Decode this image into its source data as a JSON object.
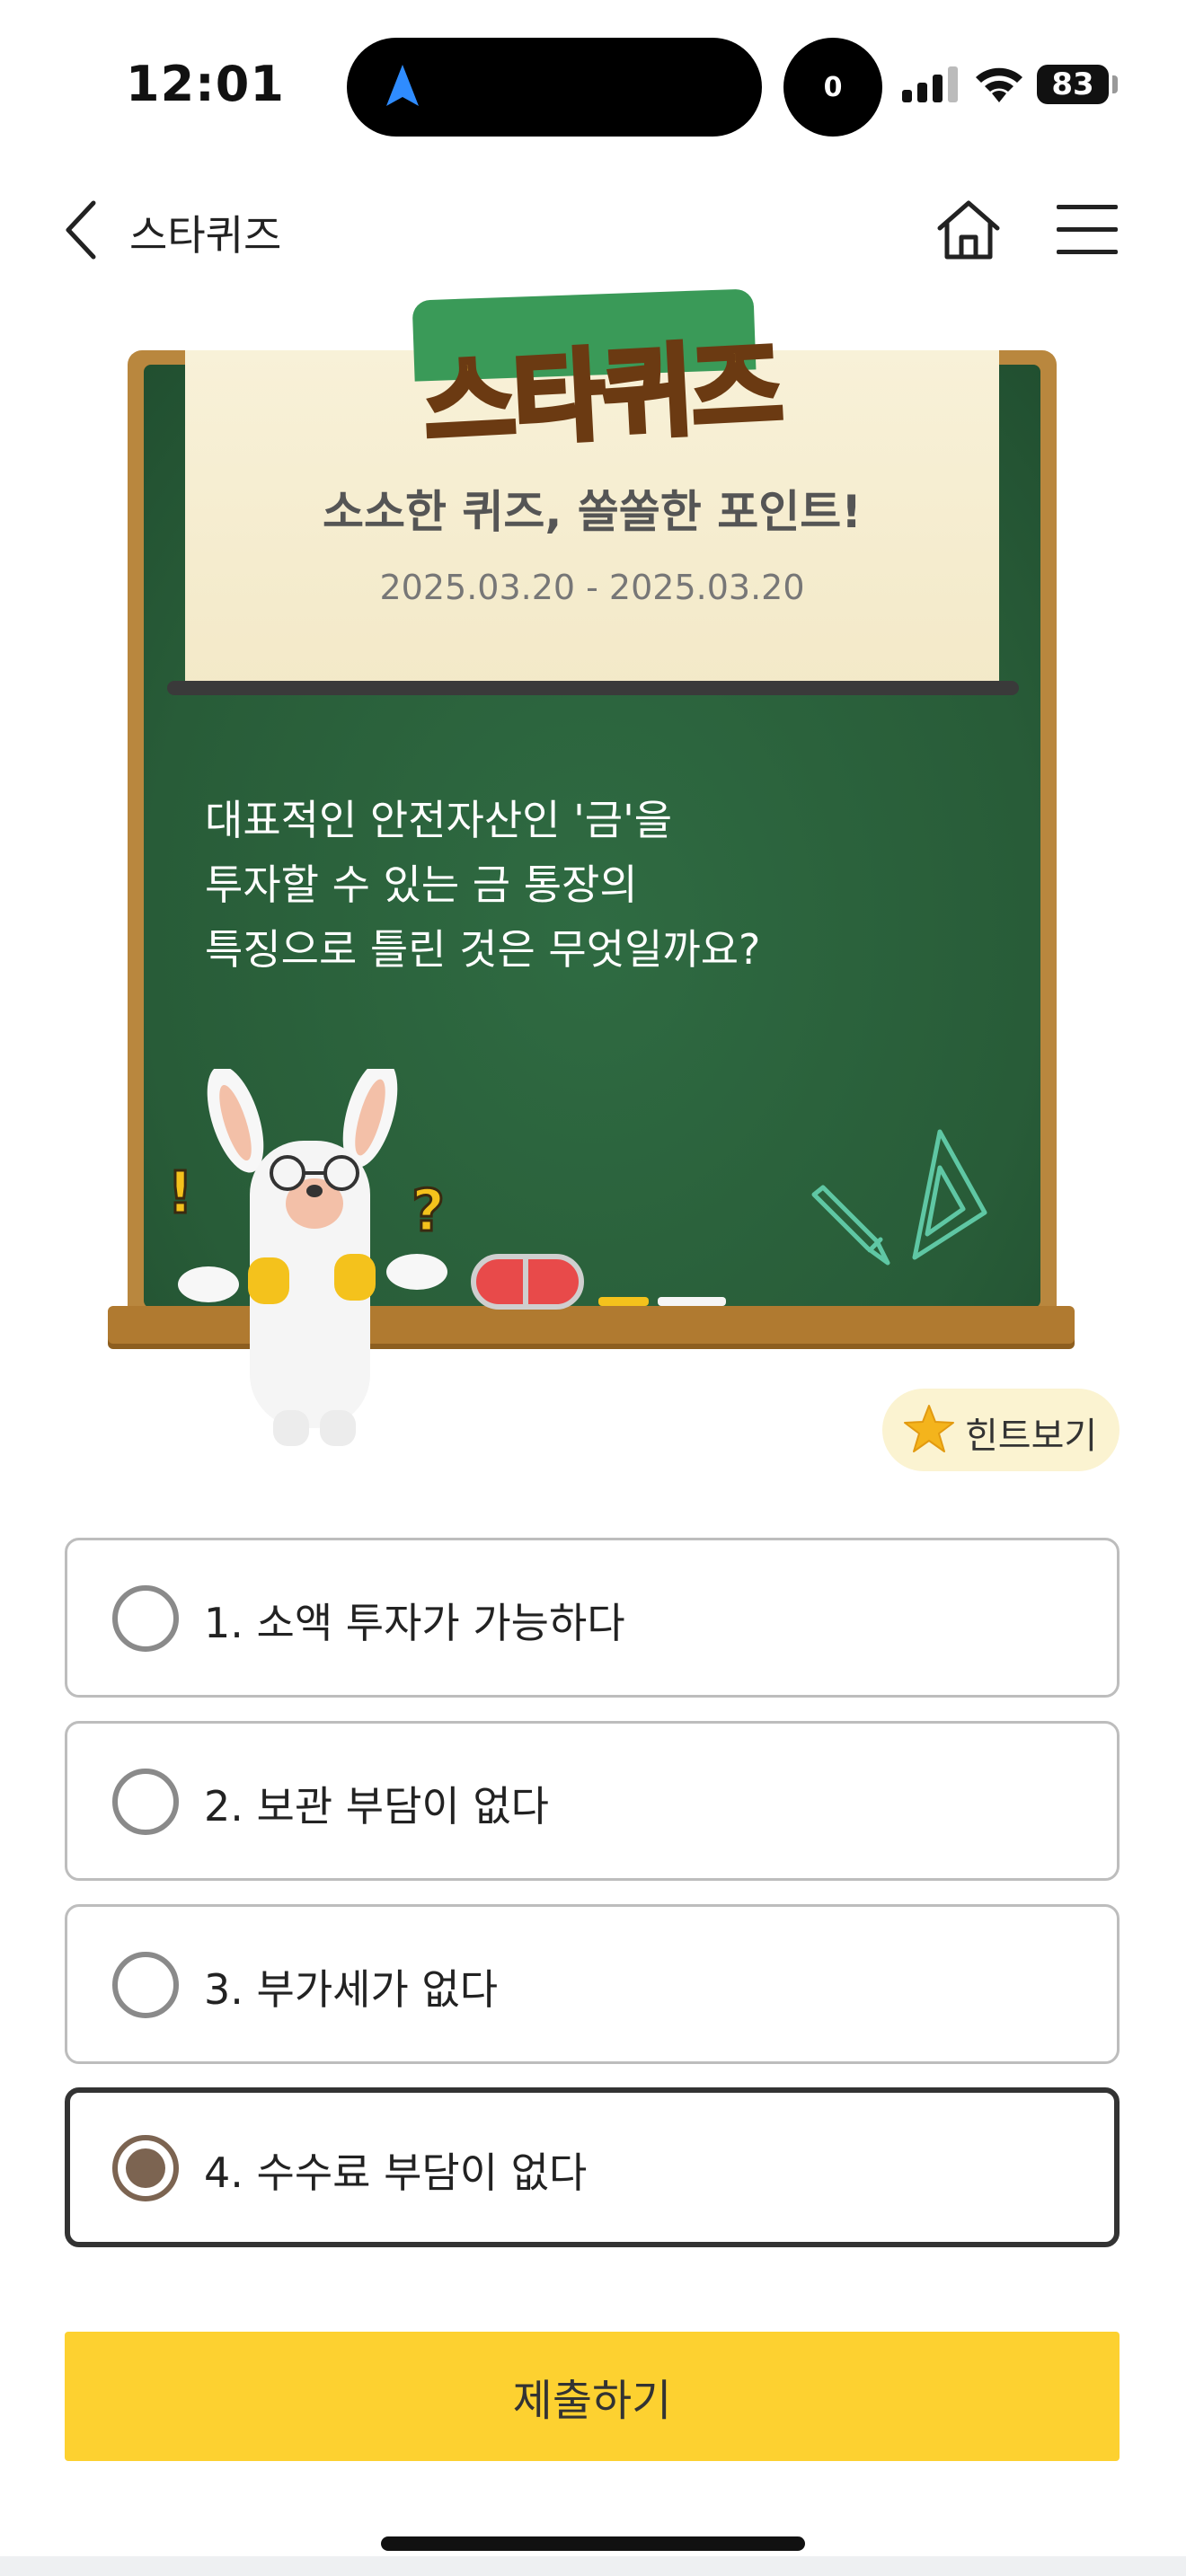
{
  "status_bar": {
    "time": "12:01",
    "notification_count": "0",
    "battery": "83"
  },
  "header": {
    "title": "스타퀴즈",
    "back_icon": "chevron-left-icon",
    "home_icon": "home-icon",
    "menu_icon": "hamburger-menu-icon"
  },
  "banner": {
    "logo_text": "스타퀴즈",
    "subtitle": "소소한 퀴즈, 쏠쏠한 포인트!",
    "dates": "2025.03.20 - 2025.03.20"
  },
  "question": {
    "lines": [
      "대표적인 안전자산인 '금'을",
      "투자할 수 있는 금 통장의",
      "특징으로 틀린 것은 무엇일까요?"
    ]
  },
  "hint": {
    "label": "힌트보기",
    "icon": "star-icon"
  },
  "options": [
    {
      "label": "1. 소액 투자가 가능하다",
      "selected": false
    },
    {
      "label": "2. 보관 부담이 없다",
      "selected": false
    },
    {
      "label": "3. 부가세가 없다",
      "selected": false
    },
    {
      "label": "4. 수수료 부담이 없다",
      "selected": true
    }
  ],
  "submit": {
    "label": "제출하기"
  },
  "colors": {
    "board_green": "#285c38",
    "frame_wood": "#b9873e",
    "submit_yellow": "#fdd130",
    "radio_selected": "#7c6451",
    "hint_bg": "#fbf3d1"
  }
}
